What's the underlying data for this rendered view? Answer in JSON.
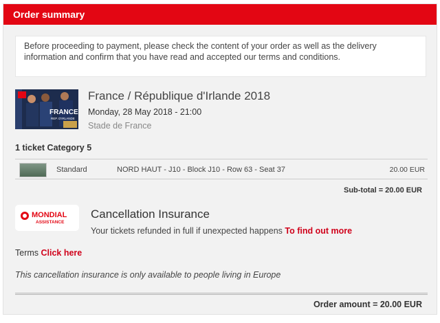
{
  "header": {
    "title": "Order summary"
  },
  "notice": {
    "text": "Before proceeding to payment, please check the content of your order as well as the delivery information and confirm that you have read and accepted our terms and conditions."
  },
  "event": {
    "image_label": "FRANCE",
    "image_sublabel": "REP. D'IRLANDE",
    "title": "France / République d'Irlande 2018",
    "date": "Monday, 28 May 2018 - 21:00",
    "venue": "Stade de France"
  },
  "tickets": {
    "count_label": "1 ticket Category 5",
    "rows": [
      {
        "type": "Standard",
        "seat": "NORD HAUT - J10 - Block J10 - Row 63 - Seat 37",
        "price": "20.00 EUR"
      }
    ],
    "subtotal": "Sub-total = 20.00 EUR"
  },
  "insurance": {
    "logo_name": "MONDIAL",
    "logo_sub": "ASSISTANCE",
    "title": "Cancellation Insurance",
    "text": "Your tickets refunded in full if unexpected happens ",
    "link": "To find out more",
    "terms_label": "Terms ",
    "terms_link": "Click here",
    "note": "This cancellation insurance is only available to people living in Europe"
  },
  "order": {
    "amount": "Order amount = 20.00 EUR"
  },
  "colors": {
    "accent": "#e30613",
    "link": "#d0021b",
    "panel_bg": "#f2f2f2"
  }
}
